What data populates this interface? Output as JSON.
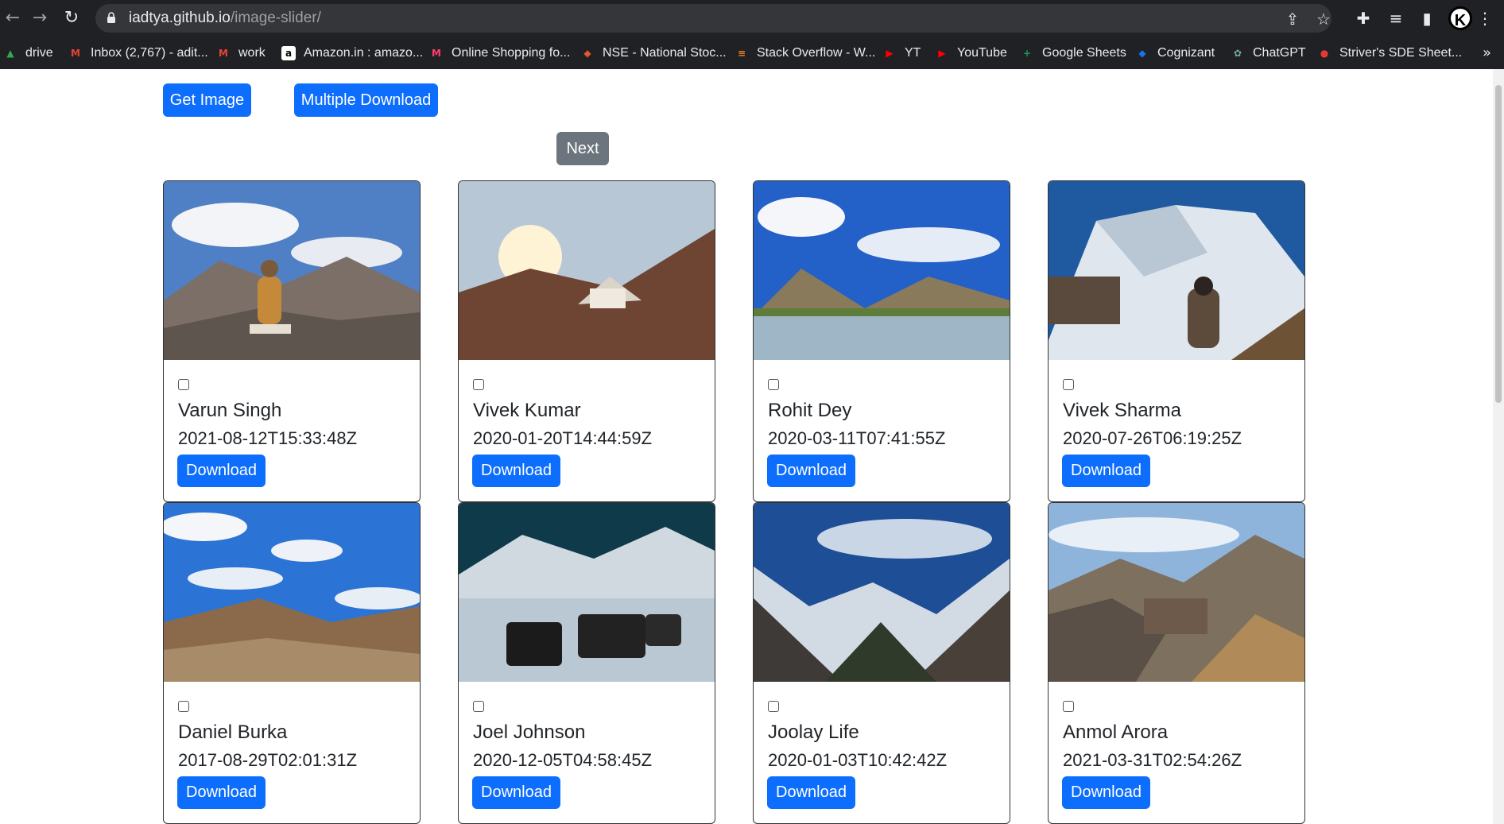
{
  "browser": {
    "url_host": "iadtya.github.io",
    "url_path": "/image-slider/",
    "bookmarks": [
      {
        "label": "drive",
        "color": "#34a853",
        "glyph": "▲"
      },
      {
        "label": "Inbox (2,767) - adit...",
        "color": "#ea4335",
        "glyph": "M"
      },
      {
        "label": "work",
        "color": "#ea4335",
        "glyph": "M"
      },
      {
        "label": "Amazon.in : amazo...",
        "color": "#ffffff",
        "glyph": "a"
      },
      {
        "label": "Online Shopping fo...",
        "color": "#ff3f6c",
        "glyph": "M"
      },
      {
        "label": "NSE - National Stoc...",
        "color": "#e8542d",
        "glyph": "◆"
      },
      {
        "label": "Stack Overflow - W...",
        "color": "#f48024",
        "glyph": "≡"
      },
      {
        "label": "YT",
        "color": "#ff0000",
        "glyph": "▶"
      },
      {
        "label": "YouTube",
        "color": "#ff0000",
        "glyph": "▶"
      },
      {
        "label": "Google Sheets",
        "color": "#0f9d58",
        "glyph": "+"
      },
      {
        "label": "Cognizant",
        "color": "#1a73e8",
        "glyph": "◆"
      },
      {
        "label": "ChatGPT",
        "color": "#74aa9c",
        "glyph": "✿"
      },
      {
        "label": "Striver's SDE Sheet...",
        "color": "#e53935",
        "glyph": "●"
      }
    ]
  },
  "toolbar": {
    "get_image_label": "Get Image",
    "multiple_download_label": "Multiple Download",
    "next_label": "Next"
  },
  "cards": [
    {
      "name": "Varun Singh",
      "date": "2021-08-12T15:33:48Z",
      "download_label": "Download"
    },
    {
      "name": "Vivek Kumar",
      "date": "2020-01-20T14:44:59Z",
      "download_label": "Download"
    },
    {
      "name": "Rohit Dey",
      "date": "2020-03-11T07:41:55Z",
      "download_label": "Download"
    },
    {
      "name": "Vivek Sharma",
      "date": "2020-07-26T06:19:25Z",
      "download_label": "Download"
    },
    {
      "name": "Daniel Burka",
      "date": "2017-08-29T02:01:31Z",
      "download_label": "Download"
    },
    {
      "name": "Joel Johnson",
      "date": "2020-12-05T04:58:45Z",
      "download_label": "Download"
    },
    {
      "name": "Joolay Life",
      "date": "2020-01-03T10:42:42Z",
      "download_label": "Download"
    },
    {
      "name": "Anmol Arora",
      "date": "2021-03-31T02:54:26Z",
      "download_label": "Download"
    }
  ]
}
